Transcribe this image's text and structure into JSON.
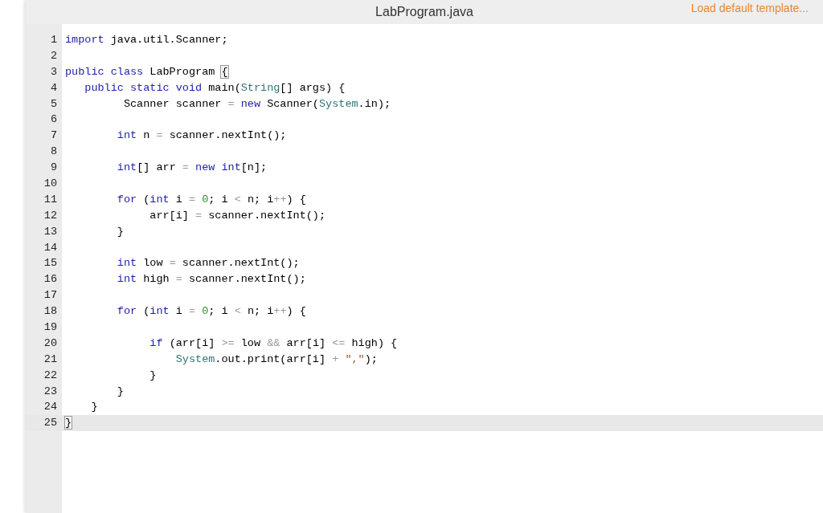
{
  "header": {
    "title": "LabProgram.java",
    "action": "Load default template..."
  },
  "editor": {
    "lines": [
      {
        "number": "1",
        "active": false,
        "tokens": [
          {
            "text": "import",
            "kind": "keyword"
          },
          {
            "text": " java.util.Scanner;",
            "kind": "plain"
          }
        ]
      },
      {
        "number": "2",
        "active": false
      },
      {
        "number": "3",
        "active": false,
        "tokens": [
          {
            "text": "public class",
            "kind": "keyword"
          },
          {
            "text": " LabProgram ",
            "kind": "plain"
          },
          {
            "text": "{",
            "kind": "matched-bracket"
          }
        ]
      },
      {
        "number": "4",
        "active": false,
        "tokens": [
          {
            "text": "   public static void",
            "kind": "keyword"
          },
          {
            "text": " main(",
            "kind": "plain"
          },
          {
            "text": "String",
            "kind": "type"
          },
          {
            "text": "[] args) {",
            "kind": "plain"
          }
        ]
      },
      {
        "number": "5",
        "active": false,
        "tokens": [
          {
            "text": "         Scanner scanner ",
            "kind": "plain"
          },
          {
            "text": "=",
            "kind": "operator"
          },
          {
            "text": " new",
            "kind": "keyword"
          },
          {
            "text": " Scanner(",
            "kind": "plain"
          },
          {
            "text": "System",
            "kind": "type"
          },
          {
            "text": ".in);",
            "kind": "plain"
          }
        ]
      },
      {
        "number": "6",
        "active": false
      },
      {
        "number": "7",
        "active": false,
        "tokens": [
          {
            "text": "        int",
            "kind": "keyword"
          },
          {
            "text": " n ",
            "kind": "plain"
          },
          {
            "text": "=",
            "kind": "operator"
          },
          {
            "text": " scanner.nextInt();",
            "kind": "plain"
          }
        ]
      },
      {
        "number": "8",
        "active": false
      },
      {
        "number": "9",
        "active": false,
        "tokens": [
          {
            "text": "        int",
            "kind": "keyword"
          },
          {
            "text": "[] arr ",
            "kind": "plain"
          },
          {
            "text": "=",
            "kind": "operator"
          },
          {
            "text": " new int",
            "kind": "keyword"
          },
          {
            "text": "[n];",
            "kind": "plain"
          }
        ]
      },
      {
        "number": "10",
        "active": false
      },
      {
        "number": "11",
        "active": false,
        "tokens": [
          {
            "text": "        for",
            "kind": "keyword"
          },
          {
            "text": " (",
            "kind": "plain"
          },
          {
            "text": "int",
            "kind": "keyword"
          },
          {
            "text": " i ",
            "kind": "plain"
          },
          {
            "text": "=",
            "kind": "operator"
          },
          {
            "text": " 0",
            "kind": "number"
          },
          {
            "text": "; i ",
            "kind": "plain"
          },
          {
            "text": "<",
            "kind": "operator"
          },
          {
            "text": " n; i",
            "kind": "plain"
          },
          {
            "text": "++",
            "kind": "operator"
          },
          {
            "text": ") {",
            "kind": "plain"
          }
        ]
      },
      {
        "number": "12",
        "active": false,
        "tokens": [
          {
            "text": "             arr[i] ",
            "kind": "plain"
          },
          {
            "text": "=",
            "kind": "operator"
          },
          {
            "text": " scanner.nextInt();",
            "kind": "plain"
          }
        ]
      },
      {
        "number": "13",
        "active": false,
        "tokens": [
          {
            "text": "        }",
            "kind": "plain"
          }
        ]
      },
      {
        "number": "14",
        "active": false
      },
      {
        "number": "15",
        "active": false,
        "tokens": [
          {
            "text": "        int",
            "kind": "keyword"
          },
          {
            "text": " low ",
            "kind": "plain"
          },
          {
            "text": "=",
            "kind": "operator"
          },
          {
            "text": " scanner.nextInt();",
            "kind": "plain"
          }
        ]
      },
      {
        "number": "16",
        "active": false,
        "tokens": [
          {
            "text": "        int",
            "kind": "keyword"
          },
          {
            "text": " high ",
            "kind": "plain"
          },
          {
            "text": "=",
            "kind": "operator"
          },
          {
            "text": " scanner.nextInt();",
            "kind": "plain"
          }
        ]
      },
      {
        "number": "17",
        "active": false
      },
      {
        "number": "18",
        "active": false,
        "tokens": [
          {
            "text": "        for",
            "kind": "keyword"
          },
          {
            "text": " (",
            "kind": "plain"
          },
          {
            "text": "int",
            "kind": "keyword"
          },
          {
            "text": " i ",
            "kind": "plain"
          },
          {
            "text": "=",
            "kind": "operator"
          },
          {
            "text": " 0",
            "kind": "number"
          },
          {
            "text": "; i ",
            "kind": "plain"
          },
          {
            "text": "<",
            "kind": "operator"
          },
          {
            "text": " n; i",
            "kind": "plain"
          },
          {
            "text": "++",
            "kind": "operator"
          },
          {
            "text": ") {",
            "kind": "plain"
          }
        ]
      },
      {
        "number": "19",
        "active": false
      },
      {
        "number": "20",
        "active": false,
        "tokens": [
          {
            "text": "             if",
            "kind": "keyword"
          },
          {
            "text": " (arr[i] ",
            "kind": "plain"
          },
          {
            "text": ">=",
            "kind": "operator"
          },
          {
            "text": " low ",
            "kind": "plain"
          },
          {
            "text": "&&",
            "kind": "operator"
          },
          {
            "text": " arr[i] ",
            "kind": "plain"
          },
          {
            "text": "<=",
            "kind": "operator"
          },
          {
            "text": " high) {",
            "kind": "plain"
          }
        ]
      },
      {
        "number": "21",
        "active": false,
        "tokens": [
          {
            "text": "                 System",
            "kind": "type"
          },
          {
            "text": ".out.print(arr[i] ",
            "kind": "plain"
          },
          {
            "text": "+",
            "kind": "operator"
          },
          {
            "text": " \",\"",
            "kind": "string"
          },
          {
            "text": ");",
            "kind": "plain"
          }
        ]
      },
      {
        "number": "22",
        "active": false,
        "tokens": [
          {
            "text": "             }",
            "kind": "plain"
          }
        ]
      },
      {
        "number": "23",
        "active": false,
        "tokens": [
          {
            "text": "        }",
            "kind": "plain"
          }
        ]
      },
      {
        "number": "24",
        "active": false,
        "tokens": [
          {
            "text": "    }",
            "kind": "plain"
          }
        ]
      },
      {
        "number": "25",
        "active": true,
        "tokens": [
          {
            "text": "}",
            "kind": "matched-bracket"
          }
        ]
      }
    ]
  }
}
